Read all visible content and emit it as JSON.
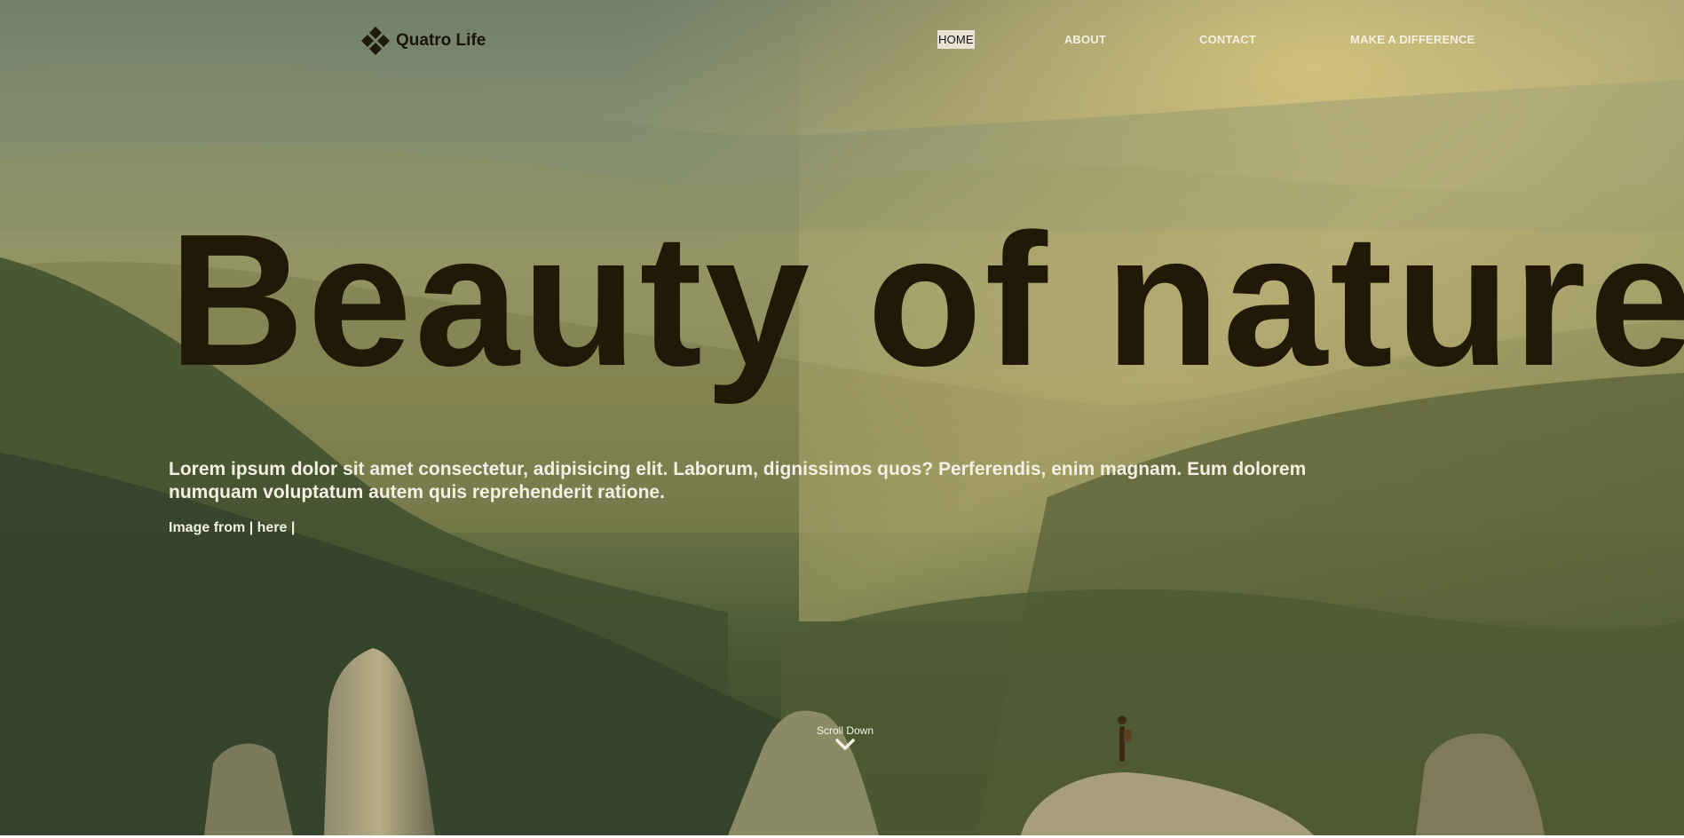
{
  "brand": {
    "name": "Quatro Life",
    "logo_icon": "diamond-quad-icon"
  },
  "nav": {
    "items": [
      {
        "label": "HOME",
        "active": true
      },
      {
        "label": "ABOUT",
        "active": false
      },
      {
        "label": "CONTACT",
        "active": false
      },
      {
        "label": "MAKE A DIFFERENCE",
        "active": false
      }
    ]
  },
  "hero": {
    "title": "Beauty of nature",
    "lead": "Lorem ipsum dolor sit amet consectetur, adipisicing elit. Laborum, dignissimos quos? Perferendis, enim magnam. Eum dolorem numquam voluptatum autem quis reprehenderit ratione.",
    "credit_prefix": "Image from |",
    "credit_link": "here",
    "credit_suffix": "|",
    "background": "mountain-valley-forest-photo"
  },
  "scroll": {
    "label": "Scroll Down",
    "icon": "chevron-down-icon"
  },
  "colors": {
    "title": "#211905",
    "text_light": "#f3efe2",
    "nav_active_bg": "#e8e2d4"
  }
}
